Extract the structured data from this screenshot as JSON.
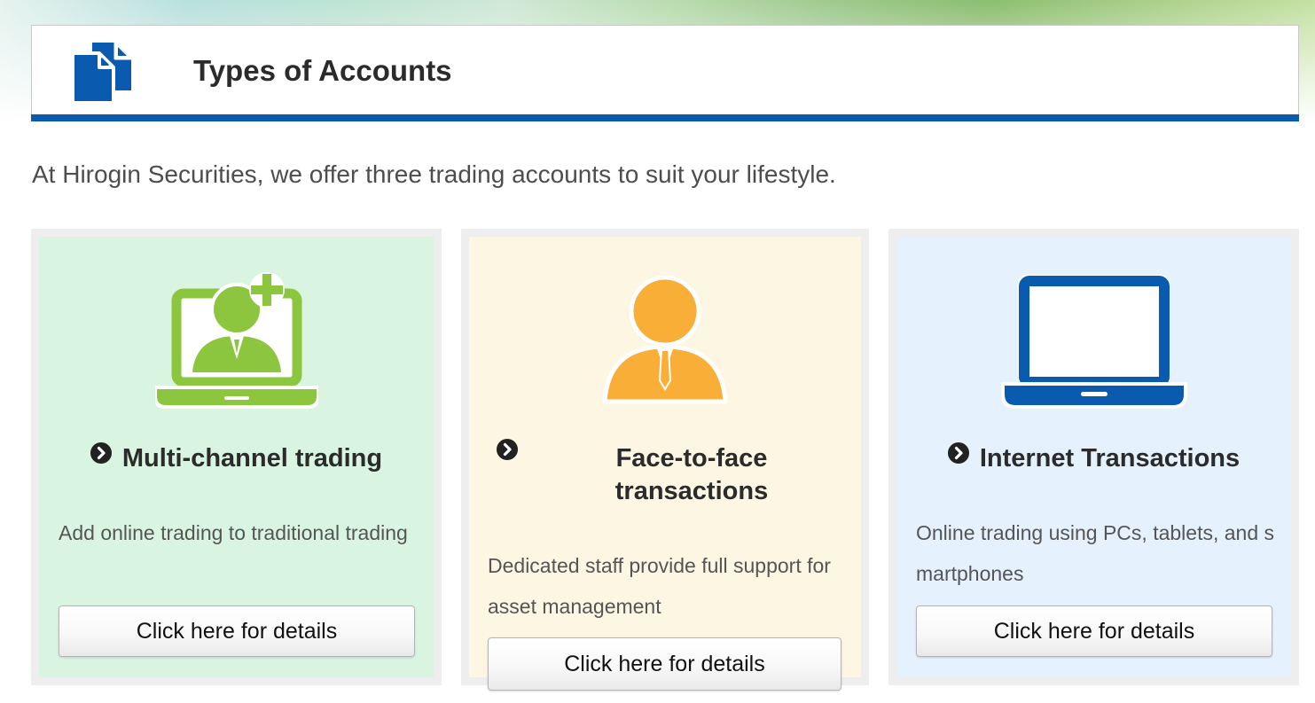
{
  "header": {
    "title": "Types of Accounts",
    "icon": "documents-icon",
    "accent_color": "#0a5bb0"
  },
  "intro": "At Hirogin Securities, we offer three trading accounts to suit your lifestyle.",
  "cards": [
    {
      "icon": "laptop-person-plus-icon",
      "title": "Multi-channel trading",
      "description": "Add online trading to traditional trading",
      "button_label": "Click here for details",
      "background": "#d9f5e2",
      "icon_color": "#8cc63f"
    },
    {
      "icon": "person-icon",
      "title": "Face-to-face transactions",
      "description": "Dedicated staff provide full support for asset management",
      "button_label": "Click here for details",
      "background": "#fcf6e3",
      "icon_color": "#f9ae37"
    },
    {
      "icon": "laptop-icon",
      "title": "Internet Transactions",
      "description": "Online trading using PCs, tablets, and smartphones",
      "button_label": "Click here for details",
      "background": "#e5f1fc",
      "icon_color": "#0a5bb0"
    }
  ]
}
